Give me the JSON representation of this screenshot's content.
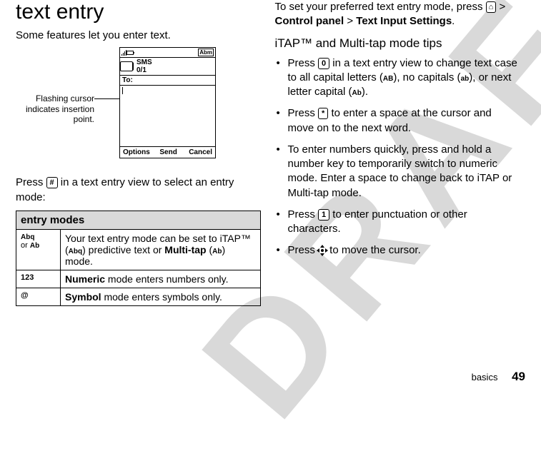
{
  "left": {
    "heading": "text entry",
    "intro": "Some features let you enter text.",
    "callout": "Flashing cursor indicates insertion point.",
    "phone": {
      "sms_label": "SMS",
      "sms_count": "0/1",
      "to_label": "To:",
      "soft_left": "Options",
      "soft_center": "Send",
      "soft_right": "Cancel",
      "ab_indicator": "Abm"
    },
    "press_line_a": "Press ",
    "press_key": "#",
    "press_line_b": " in a text entry view to select an entry mode:",
    "table": {
      "header": "entry modes",
      "row1_mode_a": "Abq",
      "row1_mode_or": "or",
      "row1_mode_b": "Ab",
      "row1_desc_a": "Your text entry mode can be set to iTAP™ (",
      "row1_desc_icon": "Abq",
      "row1_desc_b": ") predictive text or ",
      "row1_desc_multi": "Multi-tap",
      "row1_desc_c": " (",
      "row1_desc_ab": "Ab",
      "row1_desc_d": ") mode.",
      "row2_mode": "123",
      "row2_desc_a": "Numeric",
      "row2_desc_b": " mode enters numbers only.",
      "row3_mode": "@",
      "row3_desc_a": "Symbol",
      "row3_desc_b": " mode enters symbols only."
    }
  },
  "right": {
    "pref_a": "To set your preferred text entry mode, press ",
    "pref_home": "⌂",
    "pref_b": " > ",
    "pref_cp": "Control panel",
    "pref_c": " > ",
    "pref_tis": "Text Input Settings",
    "pref_d": ".",
    "h2": "iTAP™ and Multi-tap mode tips",
    "b1_a": "Press ",
    "b1_key": "0",
    "b1_b": " in a text entry view to change text case to all capital letters (",
    "b1_AB": "AB",
    "b1_c": "), no capitals (",
    "b1_ab": "ab",
    "b1_d": "), or next letter capital (",
    "b1_Ab": "Ab",
    "b1_e": ").",
    "b2_a": "Press ",
    "b2_key": "*",
    "b2_b": " to enter a space at the cursor and move on to the next word.",
    "b3": "To enter numbers quickly, press and hold a number key to temporarily switch to numeric mode. Enter a space to change back to iTAP or Multi-tap mode.",
    "b4_a": "Press ",
    "b4_key": "1",
    "b4_b": " to enter punctuation or other characters.",
    "b5_a": "Press ",
    "b5_b": " to move the cursor."
  },
  "footer": {
    "section": "basics",
    "page": "49"
  }
}
